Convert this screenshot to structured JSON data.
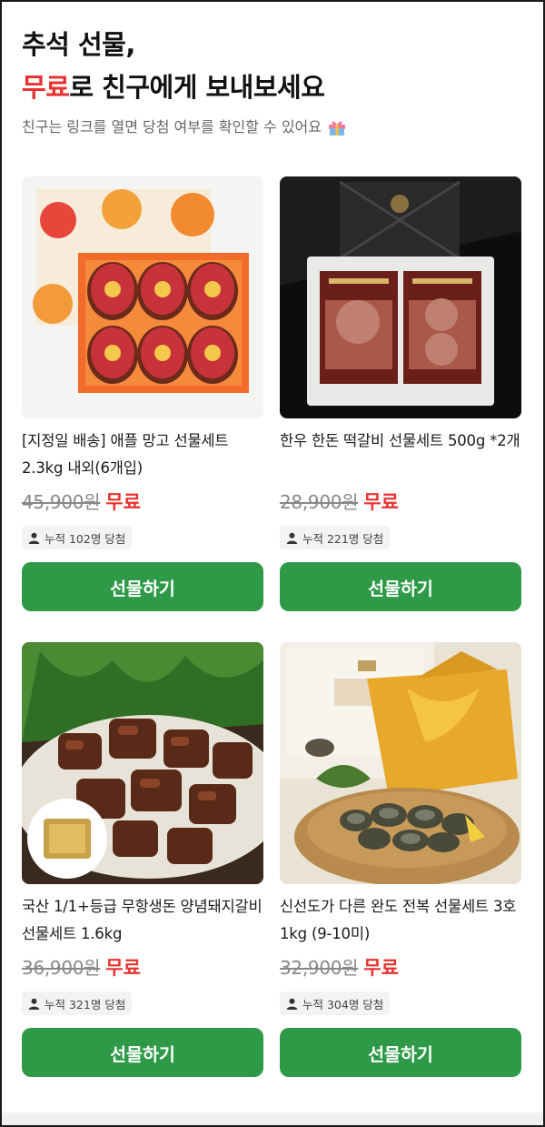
{
  "header": {
    "title_line1": "추석 선물,",
    "title_accent": "무료",
    "title_line2_rest": "로 친구에게 보내보세요",
    "subtitle": "친구는 링크를 열면 당첨 여부를 확인할 수 있어요",
    "subtitle_icon": "gift-icon"
  },
  "colors": {
    "accent_red": "#e8322f",
    "button_green": "#2e9a48"
  },
  "products": [
    {
      "name": "[지정일 배송] 애플 망고 선물세트 2.3kg 내외(6개입)",
      "original_price": "45,900원",
      "sale_label": "무료",
      "winners": "누적 102명 당첨",
      "button_label": "선물하기"
    },
    {
      "name": "한우 한돈 떡갈비 선물세트 500g *2개",
      "original_price": "28,900원",
      "sale_label": "무료",
      "winners": "누적 221명 당첨",
      "button_label": "선물하기"
    },
    {
      "name": "국산 1/1+등급 무항생돈 양념돼지갈비 선물세트 1.6kg",
      "original_price": "36,900원",
      "sale_label": "무료",
      "winners": "누적 321명 당첨",
      "button_label": "선물하기"
    },
    {
      "name": "신선도가 다른 완도 전복 선물세트 3호 1kg (9-10미)",
      "original_price": "32,900원",
      "sale_label": "무료",
      "winners": "누적 304명 당첨",
      "button_label": "선물하기"
    }
  ]
}
